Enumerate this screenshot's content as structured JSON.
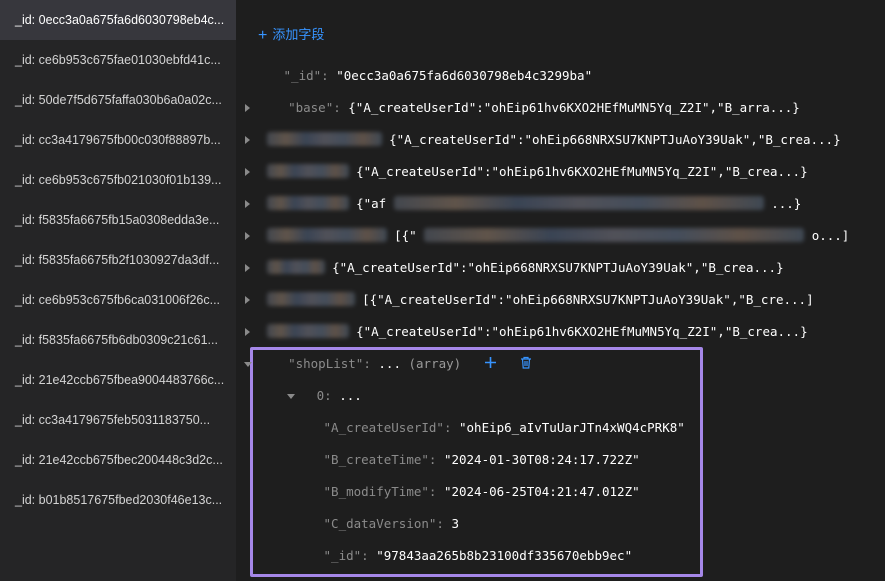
{
  "sidebar": {
    "items": [
      "_id: 0ecc3a0a675fa6d6030798eb4c...",
      "_id: ce6b953c675fae01030ebfd41c...",
      "_id: 50de7f5d675faffa030b6a0a02c...",
      "_id: cc3a4179675fb00c030f88897b...",
      "_id: ce6b953c675fb021030f01b139...",
      "_id: f5835fa6675fb15a0308edda3e...",
      "_id: f5835fa6675fb2f1030927da3df...",
      "_id: ce6b953c675fb6ca031006f26c...",
      "_id: f5835fa6675fb6db0309c21c61...",
      "_id: 21e42ccb675fbea9004483766c...",
      "_id: cc3a4179675feb5031183750...",
      "_id: 21e42ccb675fbec200448c3d2c...",
      "_id: b01b8517675fbed2030f46e13c..."
    ]
  },
  "toolbar": {
    "add_field_label": "添加字段"
  },
  "document": {
    "id_key": "\"_id\":",
    "id_value": "\"0ecc3a0a675fa6d6030798eb4c3299ba\"",
    "base_key": "\"base\":",
    "base_value": "{\"A_createUserId\":\"ohEip61hv6KXO2HEfMuMN5Yq_Z2I\",\"B_arra...}",
    "row3_value": "{\"A_createUserId\":\"ohEip668NRXSU7KNPTJuAoY39Uak\",\"B_crea...}",
    "row4_value": "{\"A_createUserId\":\"ohEip61hv6KXO2HEfMuMN5Yq_Z2I\",\"B_crea...}",
    "row5_value": "{\"af",
    "row5_tail": "...}",
    "row6_value": "[{\"",
    "row6_tail": "o...]",
    "row7_value": "{\"A_createUserId\":\"ohEip668NRXSU7KNPTJuAoY39Uak\",\"B_crea...}",
    "row8_value": "[{\"A_createUserId\":\"ohEip668NRXSU7KNPTJuAoY39Uak\",\"B_cre...]",
    "row9_value": "{\"A_createUserId\":\"ohEip61hv6KXO2HEfMuMN5Yq_Z2I\",\"B_crea...}",
    "shoplist_key": "\"shopList\":",
    "shoplist_ellipsis": "...",
    "shoplist_type": "(array)",
    "item0_key": "0:",
    "item0_ellipsis": "...",
    "fields": [
      {
        "key": "\"A_createUserId\":",
        "value": "\"ohEip6_aIvTuUarJTn4xWQ4cPRK8\""
      },
      {
        "key": "\"B_createTime\":",
        "value": "\"2024-01-30T08:24:17.722Z\""
      },
      {
        "key": "\"B_modifyTime\":",
        "value": "\"2024-06-25T04:21:47.012Z\""
      },
      {
        "key": "\"C_dataVersion\":",
        "value": "3"
      },
      {
        "key": "\"_id\":",
        "value": "\"97843aa265b8b23100df335670ebb9ec\""
      }
    ]
  },
  "colors": {
    "accent": "#3794ff",
    "highlight": "#a587e8"
  },
  "icons": {
    "add": "plus-icon",
    "delete": "trash-icon",
    "expand": "chevron-right-icon",
    "collapse": "chevron-down-icon"
  }
}
